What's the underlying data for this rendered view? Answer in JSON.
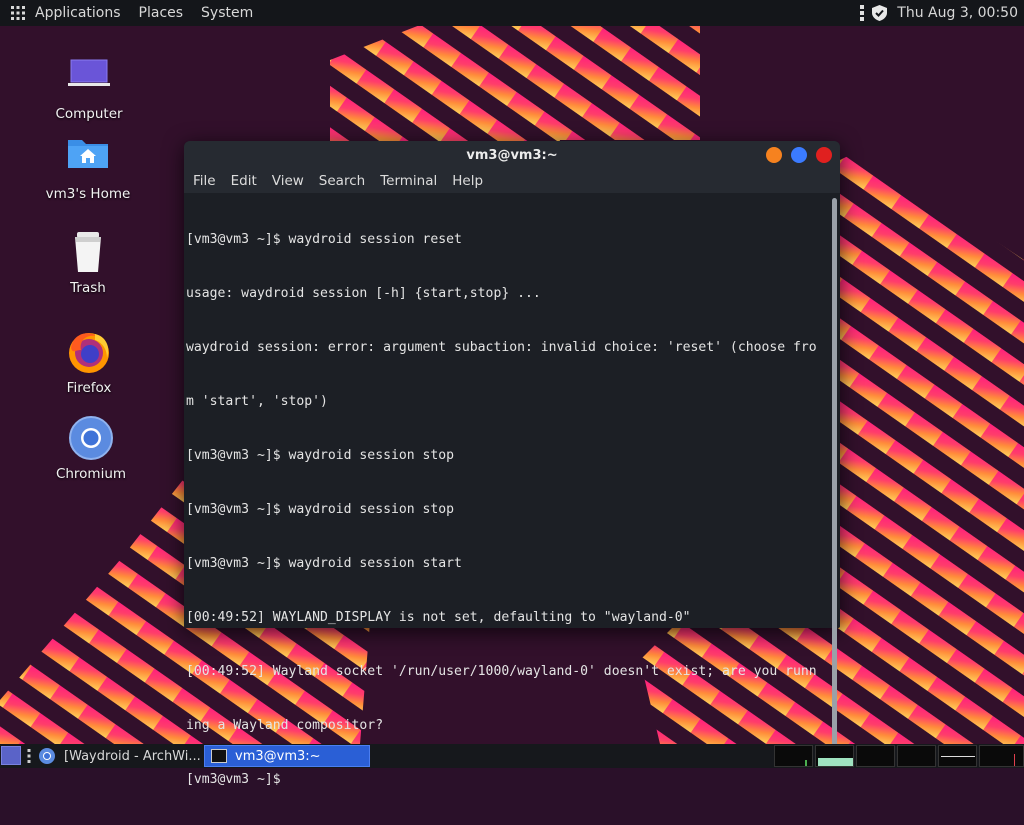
{
  "top_panel": {
    "menus": [
      "Applications",
      "Places",
      "System"
    ],
    "clock": "Thu Aug  3, 00:50",
    "icons": [
      "apps-grid-icon",
      "vertical-dots-icon",
      "shield-icon"
    ]
  },
  "desktop_icons": [
    {
      "label": "Computer",
      "icon": "computer-icon"
    },
    {
      "label": "vm3's Home",
      "icon": "home-folder-icon"
    },
    {
      "label": "Trash",
      "icon": "trash-icon"
    },
    {
      "label": "Firefox",
      "icon": "firefox-icon"
    },
    {
      "label": "Chromium",
      "icon": "chromium-icon"
    }
  ],
  "terminal": {
    "title": "vm3@vm3:~",
    "menu": [
      "File",
      "Edit",
      "View",
      "Search",
      "Terminal",
      "Help"
    ],
    "buttons": {
      "minimize_color": "#f6821f",
      "maximize_color": "#3b7bff",
      "close_color": "#e0201f"
    },
    "lines": [
      "[vm3@vm3 ~]$ waydroid session reset",
      "usage: waydroid session [-h] {start,stop} ...",
      "waydroid session: error: argument subaction: invalid choice: 'reset' (choose fro",
      "m 'start', 'stop')",
      "[vm3@vm3 ~]$ waydroid session stop",
      "[vm3@vm3 ~]$ waydroid session stop",
      "[vm3@vm3 ~]$ waydroid session start",
      "[00:49:52] WAYLAND_DISPLAY is not set, defaulting to \"wayland-0\"",
      "[00:49:52] Wayland socket '/run/user/1000/wayland-0' doesn't exist; are you runn",
      "ing a Wayland compositor?",
      "[vm3@vm3 ~]$ "
    ]
  },
  "taskbar": {
    "tasks": [
      {
        "label": "[Waydroid - ArchWi...",
        "active": false
      },
      {
        "label": "vm3@vm3:~",
        "active": true
      }
    ]
  },
  "colors": {
    "wallpaper_bg": "#2a1029",
    "stripe_pink": "#ff1f7e",
    "stripe_orange": "#ff9a3a",
    "panel": "#14161a",
    "terminal_bg": "#1c1f25",
    "active_task": "#2a5fd6"
  }
}
